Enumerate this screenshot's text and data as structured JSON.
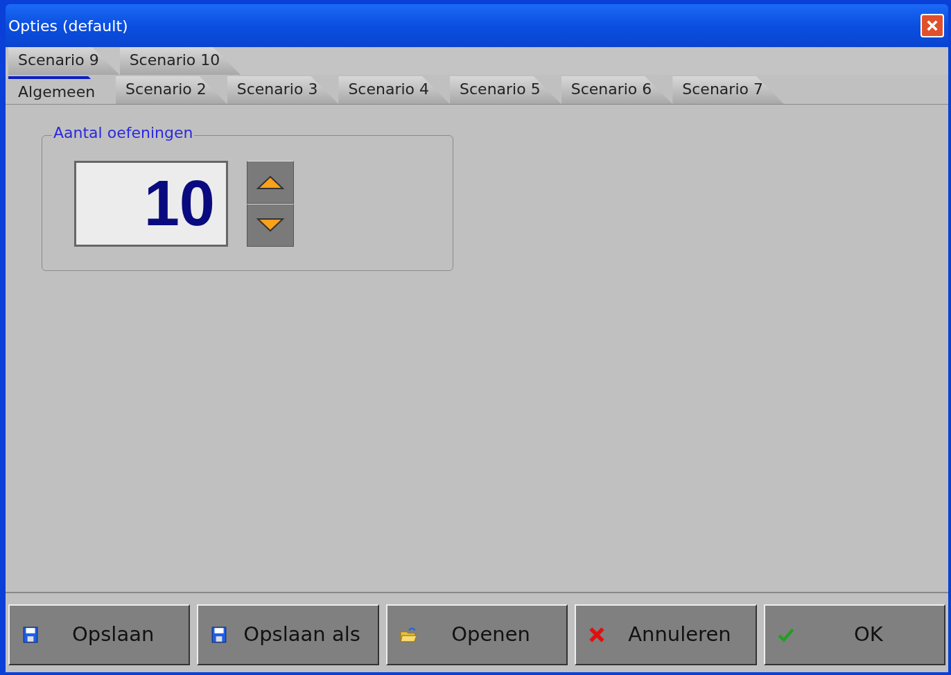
{
  "window": {
    "title": "Opties (default)"
  },
  "tab_rows": [
    {
      "tabs": [
        {
          "label": "Scenario 9",
          "selected": false
        },
        {
          "label": "Scenario 10",
          "selected": false
        }
      ]
    },
    {
      "tabs": [
        {
          "label": "Algemeen",
          "selected": true
        },
        {
          "label": "Scenario 2",
          "selected": false
        },
        {
          "label": "Scenario 3",
          "selected": false
        },
        {
          "label": "Scenario 4",
          "selected": false
        },
        {
          "label": "Scenario 5",
          "selected": false
        },
        {
          "label": "Scenario 6",
          "selected": false
        },
        {
          "label": "Scenario 7",
          "selected": false
        }
      ]
    }
  ],
  "group": {
    "title": "Aantal oefeningen",
    "value": "10"
  },
  "buttons": [
    {
      "label": "Opslaan",
      "kind": "save"
    },
    {
      "label": "Opslaan als",
      "kind": "save"
    },
    {
      "label": "Openen",
      "kind": "open"
    },
    {
      "label": "Annuleren",
      "kind": "cancel"
    },
    {
      "label": "OK",
      "kind": "ok"
    }
  ]
}
